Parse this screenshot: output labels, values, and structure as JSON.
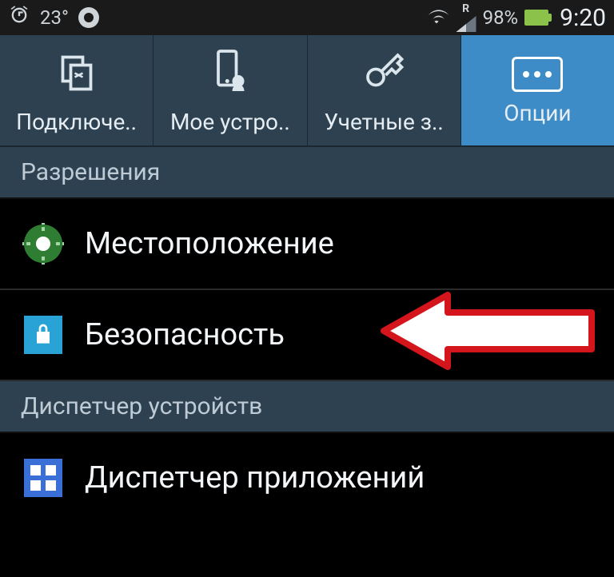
{
  "status": {
    "temperature": "23°",
    "roaming_label": "R",
    "battery_percent": "98%",
    "clock": "9:20"
  },
  "tabs": {
    "connections": "Подключе..",
    "my_device": "Мое устро..",
    "accounts": "Учетные з..",
    "options": "Опции"
  },
  "sections": {
    "permissions_header": "Разрешения",
    "device_manager_header": "Диспетчер устройств"
  },
  "items": {
    "location": "Местоположение",
    "security": "Безопасность",
    "app_manager": "Диспетчер приложений"
  }
}
